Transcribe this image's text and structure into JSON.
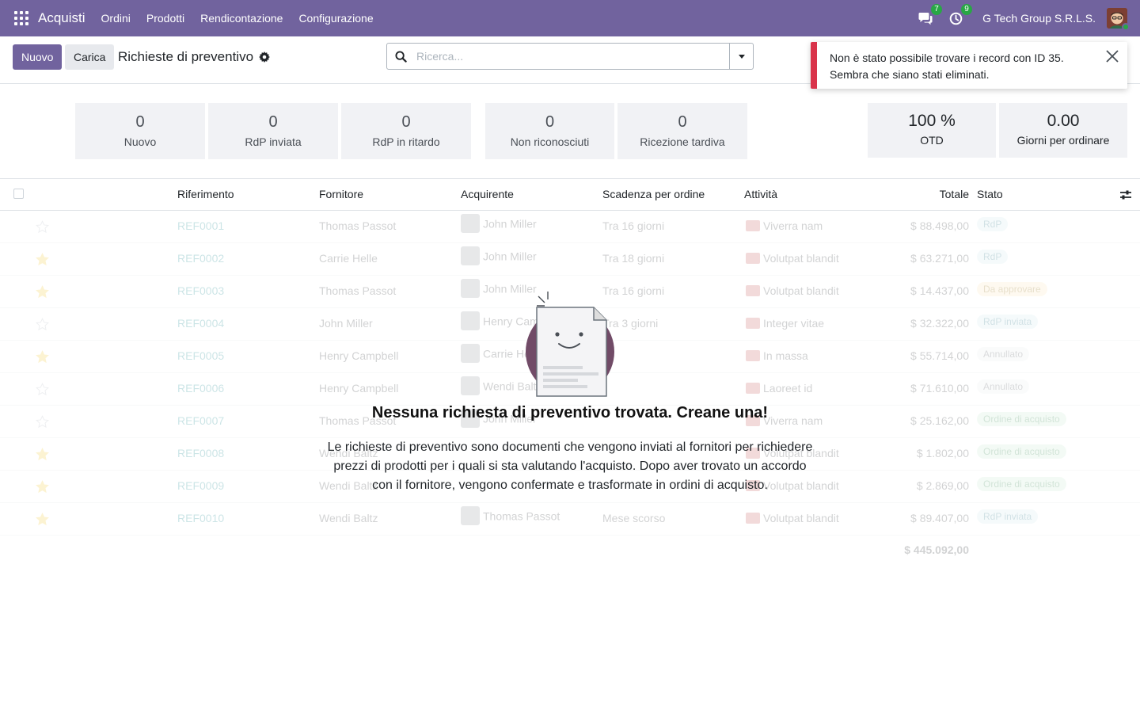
{
  "navbar": {
    "app_name": "Acquisti",
    "menu": [
      "Ordini",
      "Prodotti",
      "Rendicontazione",
      "Configurazione"
    ],
    "messages_count": "7",
    "activities_count": "9",
    "company": "G Tech Group S.R.L.S.",
    "accent": "#71639e"
  },
  "control": {
    "new_label": "Nuovo",
    "upload_label": "Carica",
    "title": "Richieste di preventivo",
    "search_placeholder": "Ricerca..."
  },
  "notification": {
    "line1": "Non è stato possibile trovare i record con ID 35.",
    "line2": "Sembra che siano stati eliminati."
  },
  "dashboard": {
    "cards": [
      {
        "value": "0",
        "label": "Nuovo"
      },
      {
        "value": "0",
        "label": "RdP inviata"
      },
      {
        "value": "0",
        "label": "RdP in ritardo"
      },
      {
        "value": "0",
        "label": "Non riconosciuti"
      },
      {
        "value": "0",
        "label": "Ricezione tardiva"
      }
    ],
    "kpis": [
      {
        "value": "100 %",
        "label": "OTD"
      },
      {
        "value": "0.00",
        "label": "Giorni per ordinare"
      }
    ]
  },
  "list": {
    "columns": {
      "ref": "Riferimento",
      "vendor": "Fornitore",
      "buyer": "Acquirente",
      "deadline": "Scadenza per ordine",
      "activity": "Attività",
      "total": "Totale",
      "status": "Stato"
    },
    "rows": [
      {
        "starred": false,
        "ref": "REF0001",
        "vendor": "Thomas Passot",
        "buyer": "John Miller",
        "deadline": "Tra 16 giorni",
        "activity": "Viverra nam",
        "total": "$ 88.498,00",
        "status": "RdP",
        "status_bg": "#cfe7ec",
        "status_fg": "#1d7080"
      },
      {
        "starred": true,
        "ref": "REF0002",
        "vendor": "Carrie Helle",
        "buyer": "John Miller",
        "deadline": "Tra 18 giorni",
        "activity": "Volutpat blandit",
        "total": "$ 63.271,00",
        "status": "RdP",
        "status_bg": "#cfe7ec",
        "status_fg": "#1d7080"
      },
      {
        "starred": true,
        "ref": "REF0003",
        "vendor": "Thomas Passot",
        "buyer": "John Miller",
        "deadline": "Tra 16 giorni",
        "activity": "Volutpat blandit",
        "total": "$ 14.437,00",
        "status": "Da approvare",
        "status_bg": "#fbe6b8",
        "status_fg": "#8a6400"
      },
      {
        "starred": false,
        "ref": "REF0004",
        "vendor": "John Miller",
        "buyer": "Henry Campbell",
        "deadline": "Tra 3 giorni",
        "activity": "Integer vitae",
        "total": "$ 32.322,00",
        "status": "RdP inviata",
        "status_bg": "#cfe7ec",
        "status_fg": "#1d7080"
      },
      {
        "starred": true,
        "ref": "REF0005",
        "vendor": "Henry Campbell",
        "buyer": "Carrie Helle",
        "deadline": "",
        "activity": "In massa",
        "total": "$ 55.714,00",
        "status": "Annullato",
        "status_bg": "#e9ecef",
        "status_fg": "#495057"
      },
      {
        "starred": false,
        "ref": "REF0006",
        "vendor": "Henry Campbell",
        "buyer": "Wendi Baltz",
        "deadline": "",
        "activity": "Laoreet id",
        "total": "$ 71.610,00",
        "status": "Annullato",
        "status_bg": "#e9ecef",
        "status_fg": "#495057"
      },
      {
        "starred": false,
        "ref": "REF0007",
        "vendor": "Thomas Passot",
        "buyer": "John Miller",
        "deadline": "",
        "activity": "Viverra nam",
        "total": "$ 25.162,00",
        "status": "Ordine di acquisto",
        "status_bg": "#c8ebd2",
        "status_fg": "#1e7a3b"
      },
      {
        "starred": true,
        "ref": "REF0008",
        "vendor": "Wendi Baltz",
        "buyer": "",
        "deadline": "",
        "activity": "Volutpat blandit",
        "total": "$ 1.802,00",
        "status": "Ordine di acquisto",
        "status_bg": "#c8ebd2",
        "status_fg": "#1e7a3b"
      },
      {
        "starred": true,
        "ref": "REF0009",
        "vendor": "Wendi Baltz",
        "buyer": "",
        "deadline": "",
        "activity": "Volutpat blandit",
        "total": "$ 2.869,00",
        "status": "Ordine di acquisto",
        "status_bg": "#c8ebd2",
        "status_fg": "#1e7a3b"
      },
      {
        "starred": true,
        "ref": "REF0010",
        "vendor": "Wendi Baltz",
        "buyer": "Thomas Passot",
        "deadline": "Mese scorso",
        "activity": "Volutpat blandit",
        "total": "$ 89.407,00",
        "status": "RdP inviata",
        "status_bg": "#cfe7ec",
        "status_fg": "#1d7080"
      }
    ],
    "grand_total": "$ 445.092,00"
  },
  "empty_state": {
    "title": "Nessuna richiesta di preventivo trovata. Creane una!",
    "line1": "Le richieste di preventivo sono documenti che vengono inviati al fornitori per richiedere",
    "line2": "prezzi di prodotti per i quali si sta valutando l'acquisto. Dopo aver trovato un accordo",
    "line3": "con il fornitore, vengono confermate e trasformate in ordini di acquisto."
  }
}
